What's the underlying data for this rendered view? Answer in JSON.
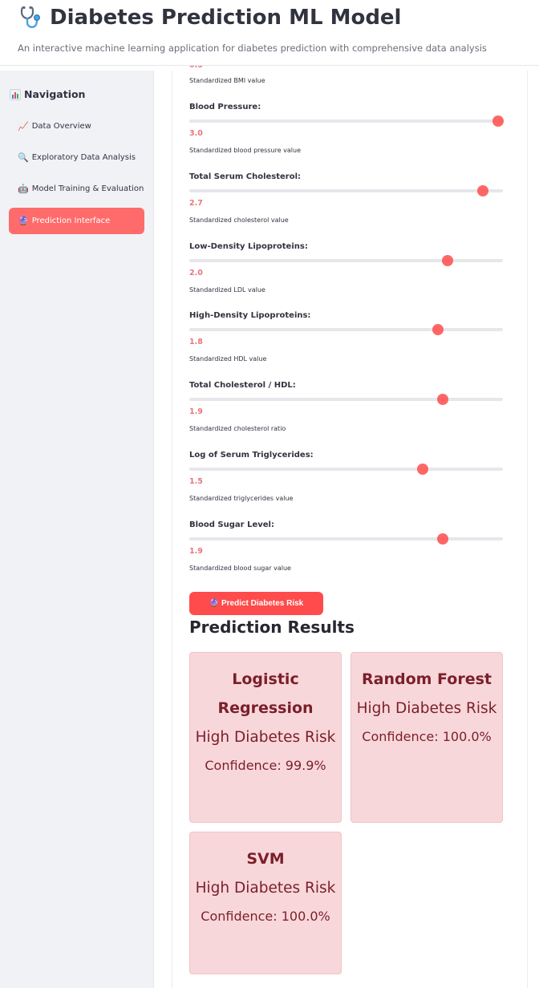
{
  "header": {
    "title": "Diabetes Prediction ML Model",
    "subtitle": "An interactive machine learning application for diabetes prediction with comprehensive data analysis"
  },
  "sidebar": {
    "title": "Navigation",
    "title_icon": "bar-chart-icon",
    "items": [
      {
        "label": "Data Overview",
        "icon": "chart-up-icon",
        "active": false
      },
      {
        "label": "Exploratory Data Analysis",
        "icon": "magnifier-icon",
        "active": false
      },
      {
        "label": "Model Training & Evaluation",
        "icon": "robot-icon",
        "active": false
      },
      {
        "label": "Prediction Interface",
        "icon": "crystal-ball-icon",
        "active": true
      }
    ]
  },
  "form": {
    "partial_top_help": "Standardized BMI value",
    "slider_range": [
      -3.0,
      3.0
    ],
    "fields": [
      {
        "label": "Blood Pressure:",
        "value": "3.0",
        "help": "Standardized blood pressure value"
      },
      {
        "label": "Total Serum Cholesterol:",
        "value": "2.7",
        "help": "Standardized cholesterol value"
      },
      {
        "label": "Low-Density Lipoproteins:",
        "value": "2.0",
        "help": "Standardized LDL value"
      },
      {
        "label": "High-Density Lipoproteins:",
        "value": "1.8",
        "help": "Standardized HDL value"
      },
      {
        "label": "Total Cholesterol / HDL:",
        "value": "1.9",
        "help": "Standardized cholesterol ratio"
      },
      {
        "label": "Log of Serum Triglycerides:",
        "value": "1.5",
        "help": "Standardized triglycerides value"
      },
      {
        "label": "Blood Sugar Level:",
        "value": "1.9",
        "help": "Standardized blood sugar value"
      }
    ],
    "predict_button": "🔮 Predict Diabetes Risk"
  },
  "results": {
    "title": "Prediction Results",
    "cards": [
      {
        "model": "Logistic Regression",
        "prediction": "High Diabetes Risk",
        "confidence": "Confidence: 99.9%"
      },
      {
        "model": "Random Forest",
        "prediction": "High Diabetes Risk",
        "confidence": "Confidence: 100.0%"
      },
      {
        "model": "SVM",
        "prediction": "High Diabetes Risk",
        "confidence": "Confidence: 100.0%"
      }
    ]
  },
  "colors": {
    "accent": "#ff4b4b",
    "sidebar_active": "#ff6b6b",
    "card_bg": "#f8d7da",
    "card_text": "#7a1f2b"
  }
}
